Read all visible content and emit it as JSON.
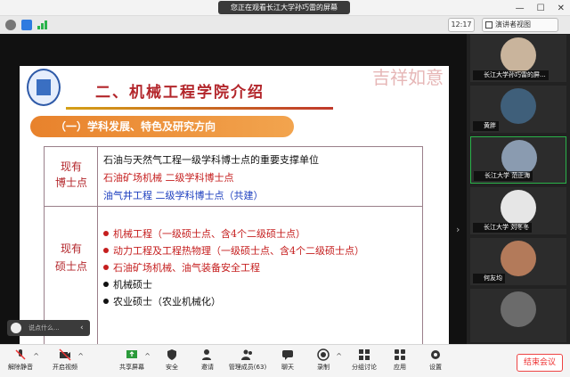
{
  "window": {
    "banner": "您正在观看长江大学孙巧雷的屏幕",
    "min": "—",
    "max": "☐",
    "close": "✕"
  },
  "status": {
    "time": "12:17",
    "view_label": "演讲者视图"
  },
  "slide": {
    "title": "二、机械工程学院介绍",
    "calligraphy": "吉祥如意",
    "section": "（一）学科发展、特色及研究方向",
    "rows": [
      {
        "label_line1": "现有",
        "label_line2": "博士点",
        "lines": [
          {
            "text": "石油与天然气工程一级学科博士点的重要支撑单位",
            "color": "black"
          },
          {
            "text": "石油矿场机械  二级学科博士点",
            "color": "red"
          },
          {
            "text": "油气井工程      二级学科博士点（共建）",
            "color": "blue"
          }
        ]
      },
      {
        "label_line1": "现有",
        "label_line2": "硕士点",
        "lines": [
          {
            "text": "机械工程（一级硕士点、含4个二级硕士点）",
            "color": "red"
          },
          {
            "text": "动力工程及工程热物理（一级硕士点、含4个二级硕士点）",
            "color": "red"
          },
          {
            "text": "石油矿场机械、油气装备安全工程",
            "color": "red"
          },
          {
            "text": "机械硕士",
            "color": "black"
          },
          {
            "text": "农业硕士（农业机械化）",
            "color": "black"
          }
        ]
      }
    ]
  },
  "participants": [
    {
      "name": "长江大学孙巧雷的屏...",
      "avatar_color": "#c9b49c"
    },
    {
      "name": "黄胖",
      "avatar_color": "#3f5f7a"
    },
    {
      "name": "长江大学 范正海",
      "avatar_color": "#8a9bb0"
    },
    {
      "name": "长江大学 刘冬冬",
      "avatar_color": "#e6e6e6"
    },
    {
      "name": "何友均",
      "avatar_color": "#b37a5a"
    },
    {
      "name": "",
      "avatar_color": "#6b6b6b"
    }
  ],
  "chat": {
    "placeholder": "说点什么...",
    "arrow": "‹"
  },
  "toolbar": {
    "mute": "解除静音",
    "video": "开启视频",
    "share": "共享屏幕",
    "security": "安全",
    "invite": "邀请",
    "members": "管理成员(63)",
    "chat": "聊天",
    "record": "录制",
    "breakout": "分组讨论",
    "apps": "应用",
    "settings": "设置",
    "end": "结束会议"
  }
}
